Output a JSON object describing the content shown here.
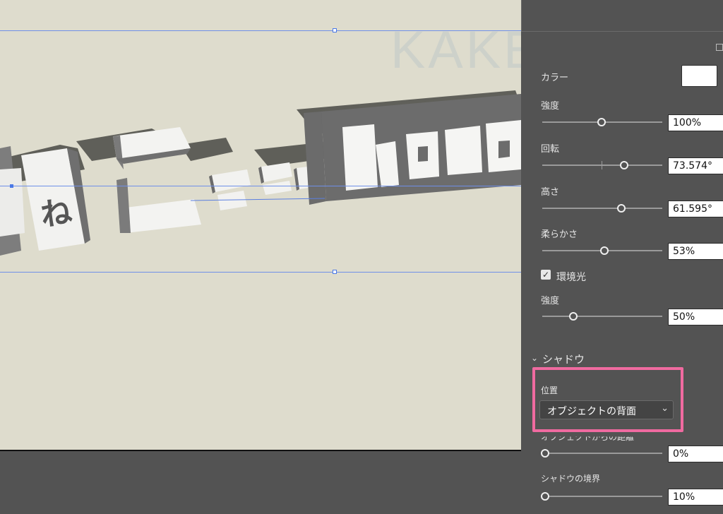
{
  "canvas": {
    "watermark": "KAKETA",
    "artwork_text": "ねこチャンkawa"
  },
  "panel": {
    "color_label": "カラー",
    "color_value": "#ffffff",
    "intensity": {
      "label": "強度",
      "value": "100%",
      "level": 0.53
    },
    "rotation": {
      "label": "回転",
      "value": "73.574°",
      "level": 0.7
    },
    "height": {
      "label": "高さ",
      "value": "61.595°",
      "level": 0.68
    },
    "softness": {
      "label": "柔らかさ",
      "value": "53%",
      "level": 0.53
    },
    "ambient": {
      "label": "環境光",
      "checked": true
    },
    "ambient_intensity": {
      "label": "強度",
      "value": "50%",
      "level": 0.25
    },
    "shadow_header": "シャドウ",
    "position": {
      "label": "位置",
      "value": "オブジェクトの背面"
    },
    "distance": {
      "label": "オブジェクトからの距離",
      "value": "0%",
      "level": 0.0
    },
    "boundary": {
      "label": "シャドウの境界",
      "value": "10%",
      "level": 0.0
    }
  }
}
